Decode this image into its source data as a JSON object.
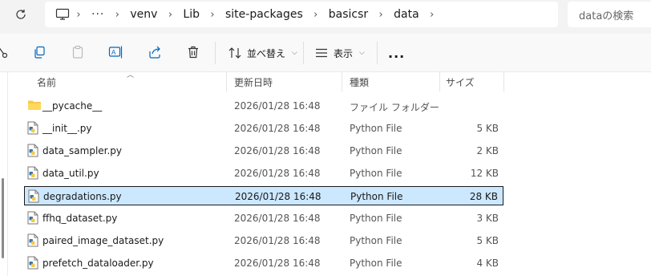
{
  "address_bar": {
    "crumbs": [
      "venv",
      "Lib",
      "site-packages",
      "basicsr",
      "data"
    ],
    "search_placeholder": "dataの検索"
  },
  "toolbar": {
    "sort_label": "並べ替え",
    "view_label": "表示",
    "more_label": "..."
  },
  "columns": {
    "name": "名前",
    "modified": "更新日時",
    "type": "種類",
    "size": "サイズ"
  },
  "files": [
    {
      "name": "__pycache__",
      "modified": "2026/01/28 16:48",
      "type": "ファイル フォルダー",
      "size": "",
      "kind": "folder-icon",
      "selected": false
    },
    {
      "name": "__init__.py",
      "modified": "2026/01/28 16:48",
      "type": "Python File",
      "size": "5 KB",
      "kind": "python-file-icon",
      "selected": false
    },
    {
      "name": "data_sampler.py",
      "modified": "2026/01/28 16:48",
      "type": "Python File",
      "size": "2 KB",
      "kind": "python-file-icon",
      "selected": false
    },
    {
      "name": "data_util.py",
      "modified": "2026/01/28 16:48",
      "type": "Python File",
      "size": "12 KB",
      "kind": "python-file-icon",
      "selected": false
    },
    {
      "name": "degradations.py",
      "modified": "2026/01/28 16:48",
      "type": "Python File",
      "size": "28 KB",
      "kind": "python-file-icon",
      "selected": true
    },
    {
      "name": "ffhq_dataset.py",
      "modified": "2026/01/28 16:48",
      "type": "Python File",
      "size": "3 KB",
      "kind": "python-file-icon",
      "selected": false
    },
    {
      "name": "paired_image_dataset.py",
      "modified": "2026/01/28 16:48",
      "type": "Python File",
      "size": "5 KB",
      "kind": "python-file-icon",
      "selected": false
    },
    {
      "name": "prefetch_dataloader.py",
      "modified": "2026/01/28 16:48",
      "type": "Python File",
      "size": "4 KB",
      "kind": "python-file-icon",
      "selected": false
    }
  ],
  "colors": {
    "selection_bg": "#cce8ff",
    "folder": "#f8c74a",
    "accent": "#0067c0"
  }
}
